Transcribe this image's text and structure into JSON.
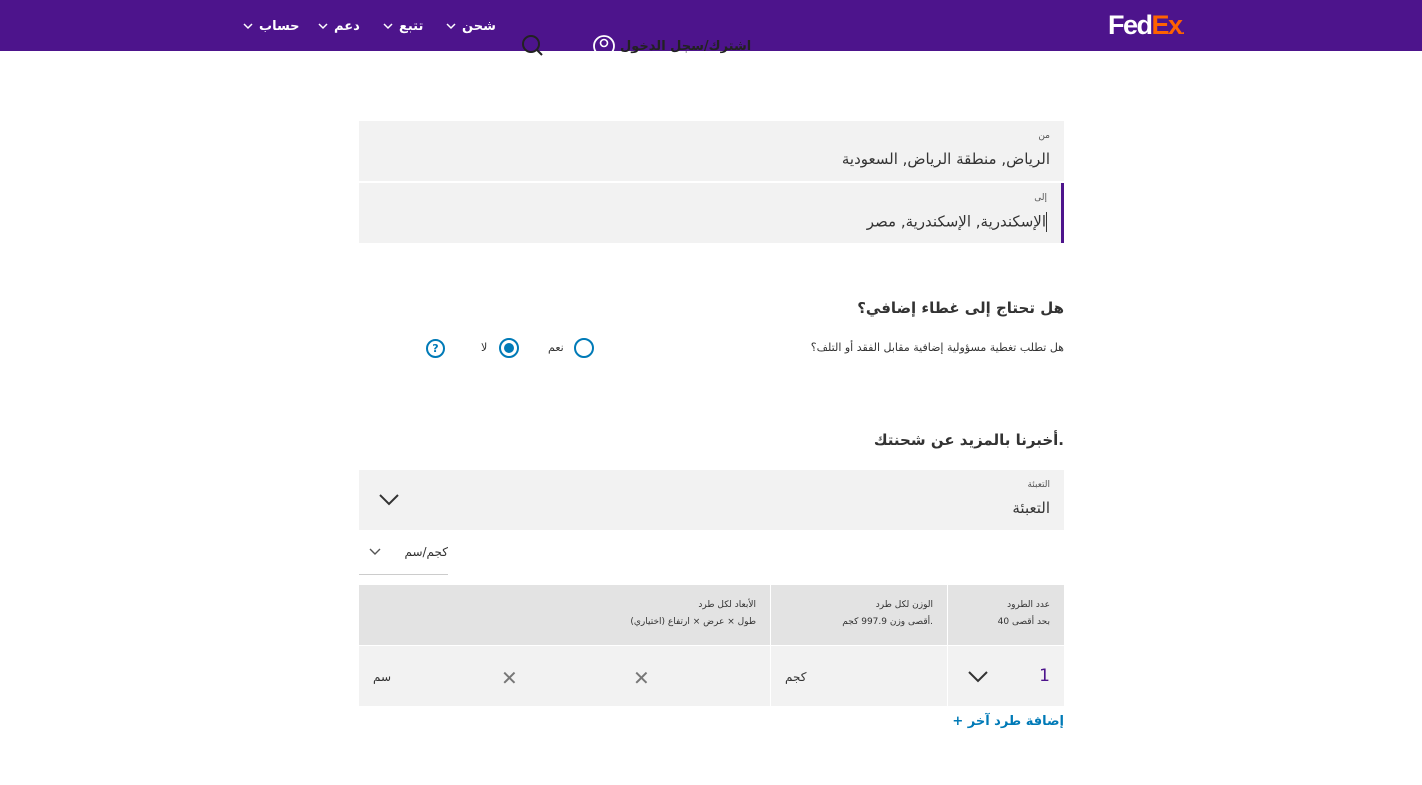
{
  "header": {
    "logo_part1": "Fed",
    "logo_part2": "Ex",
    "logo_dot": ".",
    "nav": [
      "شحن",
      "تتبع",
      "دعم",
      "حساب"
    ],
    "login_label": "اشترك/سجل الدخول"
  },
  "route": {
    "from_label": "من",
    "from_value": "الرياض, منطقة الرياض, السعودية",
    "to_label": "إلى",
    "to_value": "الإسكندرية, الإسكندرية, مصر"
  },
  "coverage": {
    "heading": "هل تحتاج إلى غطاء إضافي؟",
    "question": "هل تطلب تغطية مسؤولية إضافية مقابل الفقد أو التلف؟",
    "yes_label": "نعم",
    "no_label": "لا",
    "selected": "no",
    "help_symbol": "?"
  },
  "shipment": {
    "heading": "أخبرنا بالمزيد عن شحنتك.",
    "packaging_label": "التعبئة",
    "packaging_value": "التعبئة",
    "unit_value": "كجم/سم"
  },
  "table": {
    "col_qty_title": "عدد الطرود",
    "col_qty_sub": "بحد أقصى 40",
    "col_weight_title": "الوزن لكل طرد",
    "col_weight_sub": "أقصى وزن 997.9 كجم.",
    "col_dims_title": "الأبعاد لكل طرد",
    "col_dims_sub": "طول × عرض × ارتفاع (اختياري)",
    "qty_value": "1",
    "weight_unit": "كجم",
    "dim_unit": "سم",
    "times_symbol": "✕"
  },
  "add_package_label": "+  إضافة طرد آخر",
  "colors": {
    "brand_purple": "#4d148c",
    "brand_orange": "#ff6200",
    "link_blue": "#007ab7"
  }
}
